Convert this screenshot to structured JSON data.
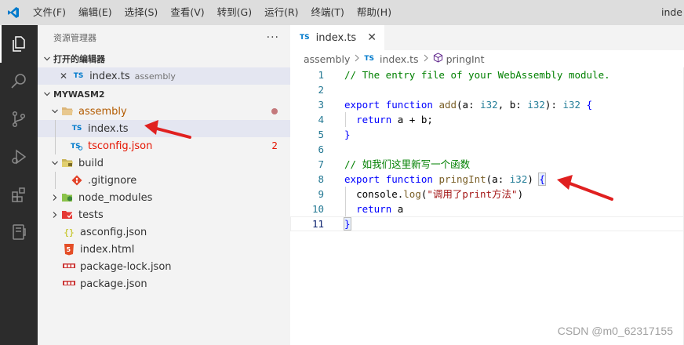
{
  "titlebar": {
    "menu": [
      "文件(F)",
      "编辑(E)",
      "选择(S)",
      "查看(V)",
      "转到(G)",
      "运行(R)",
      "终端(T)",
      "帮助(H)"
    ],
    "title_fragment": "inde",
    "accent": "#007acc"
  },
  "activitybar": {
    "icons": [
      "explorer-icon",
      "search-icon",
      "source-control-icon",
      "run-debug-icon",
      "extensions-icon",
      "remote-explorer-icon"
    ]
  },
  "sidebar": {
    "header": "资源管理器",
    "more": "···",
    "open_editors": {
      "title": "打开的编辑器",
      "items": [
        {
          "close": "✕",
          "badge": "TS",
          "name": "index.ts",
          "desc": "assembly"
        }
      ]
    },
    "project": {
      "title": "MYWASM2",
      "tree": [
        {
          "name": "assembly",
          "type": "folder-open",
          "color": "orange"
        },
        {
          "name": "index.ts",
          "type": "ts-file",
          "selected": true
        },
        {
          "name": "tsconfig.json",
          "type": "tsconfig-file",
          "problems": "2"
        },
        {
          "name": "build",
          "type": "folder-open"
        },
        {
          "name": ".gitignore",
          "type": "git-file"
        },
        {
          "name": "node_modules",
          "type": "folder-closed"
        },
        {
          "name": "tests",
          "type": "folder-closed"
        },
        {
          "name": "asconfig.json",
          "type": "json-file"
        },
        {
          "name": "index.html",
          "type": "html-file"
        },
        {
          "name": "package-lock.json",
          "type": "npm-file"
        },
        {
          "name": "package.json",
          "type": "npm-file"
        }
      ]
    }
  },
  "editor": {
    "tab": {
      "badge": "TS",
      "label": "index.ts",
      "close": "✕"
    },
    "breadcrumb": {
      "folder": "assembly",
      "badge": "TS",
      "file": "index.ts",
      "symbol": "pringInt"
    },
    "line_numbers": [
      "1",
      "2",
      "3",
      "4",
      "5",
      "6",
      "7",
      "8",
      "9",
      "10",
      "11"
    ],
    "code": {
      "l1": "// The entry file of your WebAssembly module.",
      "l3_kw1": "export",
      "l3_kw2": "function",
      "l3_fn": "add",
      "l3_p1": "(a: ",
      "l3_t1": "i32",
      "l3_p2": ", b: ",
      "l3_t2": "i32",
      "l3_p3": "): ",
      "l3_t3": "i32",
      "l3_p4": " {",
      "l4_kw": "return",
      "l4_rest": " a + b;",
      "l5": "}",
      "l7": "// 如我们这里新写一个函数",
      "l8_kw1": "export",
      "l8_kw2": "function",
      "l8_fn": "pringInt",
      "l8_p1": "(a: ",
      "l8_t1": "i32",
      "l8_p2": ") ",
      "l8_brace": "{",
      "l9_obj": "console",
      "l9_dot": ".",
      "l9_fn": "log",
      "l9_p1": "(",
      "l9_str": "\"调用了print方法\"",
      "l9_p2": ")",
      "l10_kw": "return",
      "l10_rest": " a",
      "l11": "}"
    }
  },
  "watermark": "CSDN @m0_62317155",
  "annotation_color": "#e02020"
}
